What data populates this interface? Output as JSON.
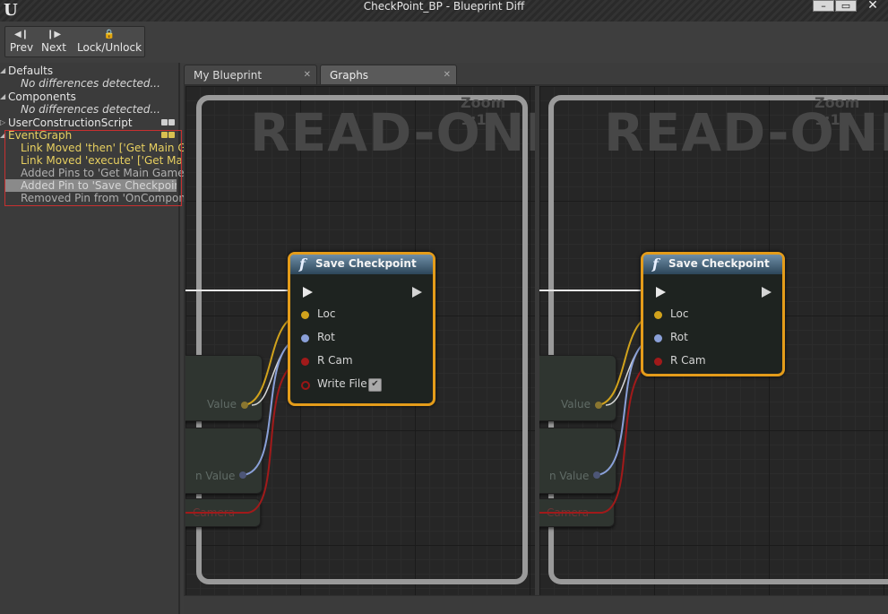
{
  "window": {
    "title": "CheckPoint_BP - Blueprint Diff",
    "logo": "U"
  },
  "toolbar": {
    "prev_label": "Prev",
    "next_label": "Next",
    "lock_label": "Lock/Unlock",
    "prev_icon": "prev-arrow-icon",
    "next_icon": "next-arrow-icon",
    "lock_icon": "lock-icon"
  },
  "tree": {
    "defaults": "Defaults",
    "defaults_child": "No differences detected...",
    "components": "Components",
    "components_child": "No differences detected...",
    "ucs": "UserConstructionScript",
    "eventgraph": "EventGraph",
    "events": [
      "Link Moved  'then' ['Get Main Game",
      "Link Moved  'execute' ['Get Main Ga",
      "Added Pins to 'Get Main Game State",
      "Added Pin to 'Save Checkpoint' ",
      "Removed Pin from 'OnComponentBeg"
    ]
  },
  "tabs": [
    {
      "label": "My Blueprint"
    },
    {
      "label": "Graphs"
    }
  ],
  "panes": {
    "zoom": "Zoom 1:1",
    "readonly": "READ-ONLY"
  },
  "node": {
    "title": "Save Checkpoint",
    "pins_left": [
      "Loc",
      "Rot",
      "R Cam",
      "Write File"
    ],
    "pins_right": [
      "Loc",
      "Rot",
      "R Cam"
    ]
  },
  "ghost": {
    "value1": "Value",
    "value2": "n Value",
    "camera": "Camera"
  },
  "colors": {
    "node_border": "#e49c1a",
    "loc_pin": "#d1a21c",
    "rot_pin": "#8aa0d8",
    "rcam_pin": "#a11a1a",
    "event_text": "#e8d060"
  }
}
